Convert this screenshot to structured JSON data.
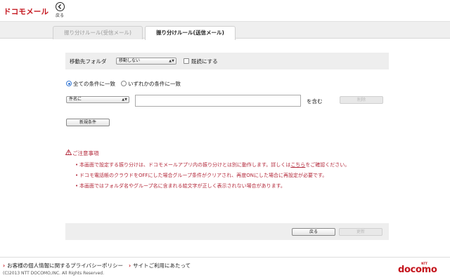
{
  "header": {
    "logo_text": "ドコモメール",
    "back_label": "戻る"
  },
  "tabs": [
    {
      "label": "振り分けルール(受信メール)",
      "active": false
    },
    {
      "label": "振り分けルール(送信メール)",
      "active": true
    }
  ],
  "folder": {
    "label": "移動先フォルダ",
    "select_value": "移動しない",
    "mark_read_label": "既読にする",
    "mark_read_checked": false
  },
  "conditions": {
    "match_all_label": "全ての条件に一致",
    "match_any_label": "いずれかの条件に一致",
    "selected": "all",
    "field_select_value": "件名に",
    "value_input": "",
    "contains_label": "を含む",
    "delete_button": "削除",
    "new_condition_button": "新規条件"
  },
  "notes": {
    "title": "ご注意事項",
    "items": [
      {
        "before": "本画面で設定する振り分けは、ドコモメールアプリ内の振り分けとは別に動作します。詳しくは",
        "link": "こちら",
        "after": "をご確認ください。"
      },
      {
        "text": "ドコモ電話帳のクラウドをOFFにした場合グループ条件がクリアされ、再度ONにした場合に再設定が必要です。"
      },
      {
        "text": "本画面ではフォルダ名やグループ名に含まれる絵文字が正しく表示されない場合があります。"
      }
    ]
  },
  "actions": {
    "back_button": "戻る",
    "update_button": "更新"
  },
  "footer": {
    "privacy_link": "お客様の個人情報に関するプライバシーポリシー",
    "terms_link": "サイトご利用にあたって",
    "copyright": "(C)2013 NTT DOCOMO,INC. All Rights Reserved.",
    "brand_small": "NTT",
    "brand_name": "docomo"
  },
  "colors": {
    "brand_red": "#c4141c",
    "notice_red": "#b3283a",
    "radio_blue": "#3a7bd5"
  }
}
